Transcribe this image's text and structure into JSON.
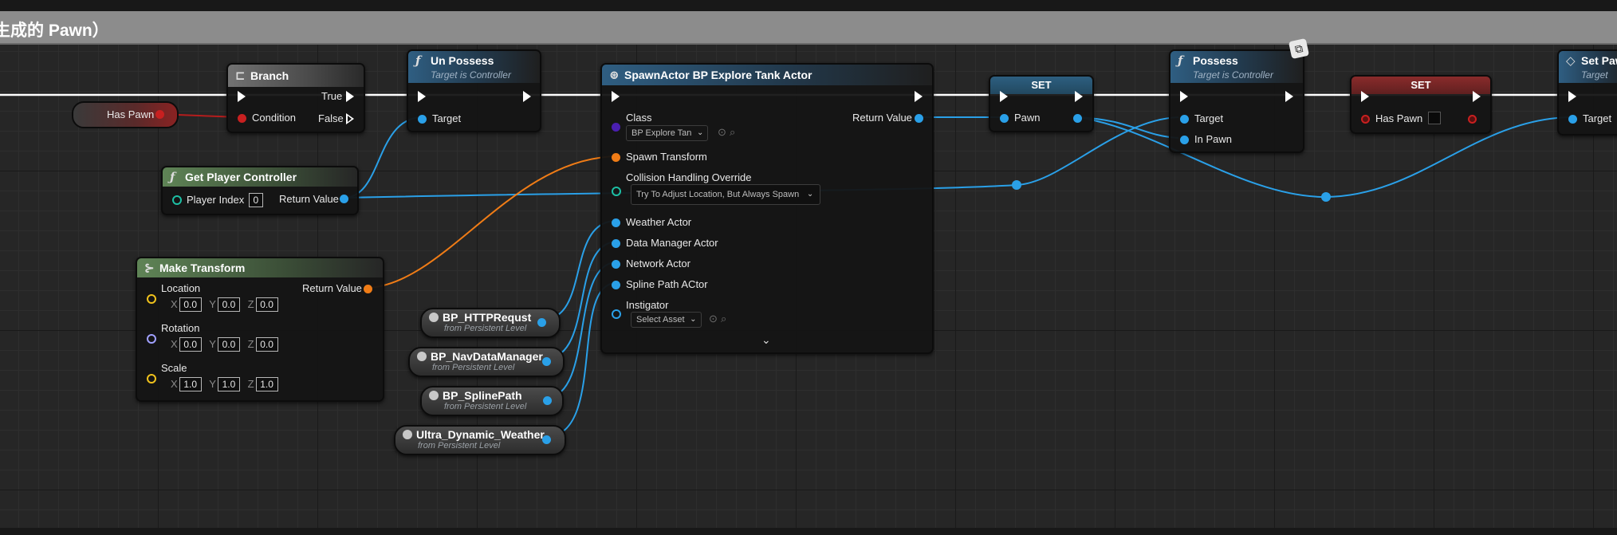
{
  "comment": {
    "title": "生成的 Pawn）"
  },
  "nodes": {
    "has_pawn_get": {
      "label": "Has Pawn"
    },
    "branch": {
      "title": "Branch",
      "true_label": "True",
      "false_label": "False",
      "condition_label": "Condition"
    },
    "unpossess": {
      "title": "Un Possess",
      "subtitle": "Target is Controller",
      "target_label": "Target"
    },
    "get_player_controller": {
      "title": "Get Player Controller",
      "player_index_label": "Player Index",
      "player_index_value": "0",
      "return_label": "Return Value"
    },
    "make_transform": {
      "title": "Make Transform",
      "return_label": "Return Value",
      "location": {
        "label": "Location",
        "x": "0.0",
        "y": "0.0",
        "z": "0.0"
      },
      "rotation": {
        "label": "Rotation",
        "x": "0.0",
        "y": "0.0",
        "z": "0.0"
      },
      "scale": {
        "label": "Scale",
        "x": "1.0",
        "y": "1.0",
        "z": "1.0"
      },
      "x_axis": "X",
      "y_axis": "Y",
      "z_axis": "Z"
    },
    "spawn_actor": {
      "title": "SpawnActor BP Explore Tank Actor",
      "class_label": "Class",
      "class_value": "BP Explore Tan",
      "return_label": "Return Value",
      "spawn_transform_label": "Spawn Transform",
      "collision_label": "Collision Handling Override",
      "collision_value": "Try To Adjust Location, But Always Spawn",
      "weather_label": "Weather Actor",
      "data_manager_label": "Data Manager Actor",
      "network_label": "Network Actor",
      "spline_label": "Spline Path ACtor",
      "instigator_label": "Instigator",
      "instigator_value": "Select Asset"
    },
    "set_pawn": {
      "title": "SET",
      "pin_label": "Pawn"
    },
    "possess": {
      "title": "Possess",
      "subtitle": "Target is Controller",
      "target_label": "Target",
      "in_pawn_label": "In Pawn"
    },
    "set_has_pawn": {
      "title": "SET",
      "pin_label": "Has Pawn"
    },
    "set_pawn_fn": {
      "title": "Set Paw",
      "subtitle": "Target",
      "target_label": "Target"
    },
    "refs": [
      {
        "title": "BP_HTTPRequst",
        "sub": "from Persistent Level"
      },
      {
        "title": "BP_NavDataManager",
        "sub": "from Persistent Level"
      },
      {
        "title": "BP_SplinePath",
        "sub": "from Persistent Level"
      },
      {
        "title": "Ultra_Dynamic_Weather",
        "sub": "from Persistent Level"
      }
    ]
  },
  "colors": {
    "exec": "#ffffff",
    "object_pin": "#2aa0e8",
    "transform_pin": "#f07c16",
    "bool_pin": "#c82020",
    "class_pin": "#4a1fb0"
  }
}
